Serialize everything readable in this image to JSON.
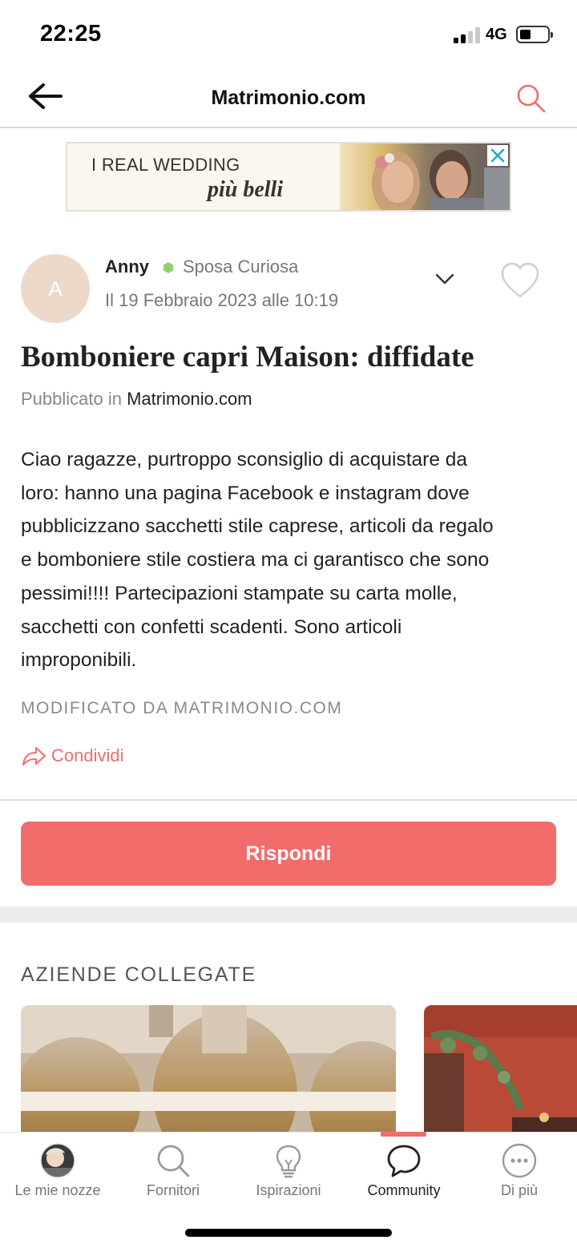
{
  "status_bar": {
    "time": "22:25",
    "network": "4G"
  },
  "header": {
    "title": "Matrimonio.com"
  },
  "ad": {
    "line1": "I REAL WEDDING",
    "line2": "più belli"
  },
  "post": {
    "author_initial": "A",
    "author": "Anny",
    "rank": "Sposa Curiosa",
    "date": "Il 19 Febbraio 2023 alle 10:19",
    "title": "Bomboniere capri Maison: diffidate",
    "published_prefix": "Pubblicato in",
    "published_category": "Matrimonio.com",
    "body_lines": [
      "Ciao ragazze, purtroppo sconsiglio di acquistare da",
      "loro: hanno una pagina Facebook e instagram dove",
      "pubblicizzano sacchetti stile caprese, articoli da regalo",
      "e bomboniere stile costiera ma ci garantisco che sono",
      "pessimi!!!! Partecipazioni stampate su carta molle,",
      "sacchetti con confetti scadenti. Sono articoli",
      "improponibili."
    ],
    "modified_note": "MODIFICATO DA MATRIMONIO.COM",
    "share_label": "Condividi"
  },
  "reply_button": "Rispondi",
  "related": {
    "title": "AZIENDE COLLEGATE"
  },
  "tabs": [
    {
      "label": "Le mie nozze",
      "icon": "profile-photo-icon"
    },
    {
      "label": "Fornitori",
      "icon": "search-icon"
    },
    {
      "label": "Ispirazioni",
      "icon": "lightbulb-icon"
    },
    {
      "label": "Community",
      "icon": "speech-bubble-icon",
      "active": true
    },
    {
      "label": "Di più",
      "icon": "more-dots-icon"
    }
  ],
  "colors": {
    "accent": "#f26c6c",
    "rank_dot": "#8fd16a",
    "ad_close": "#25a9c9"
  }
}
